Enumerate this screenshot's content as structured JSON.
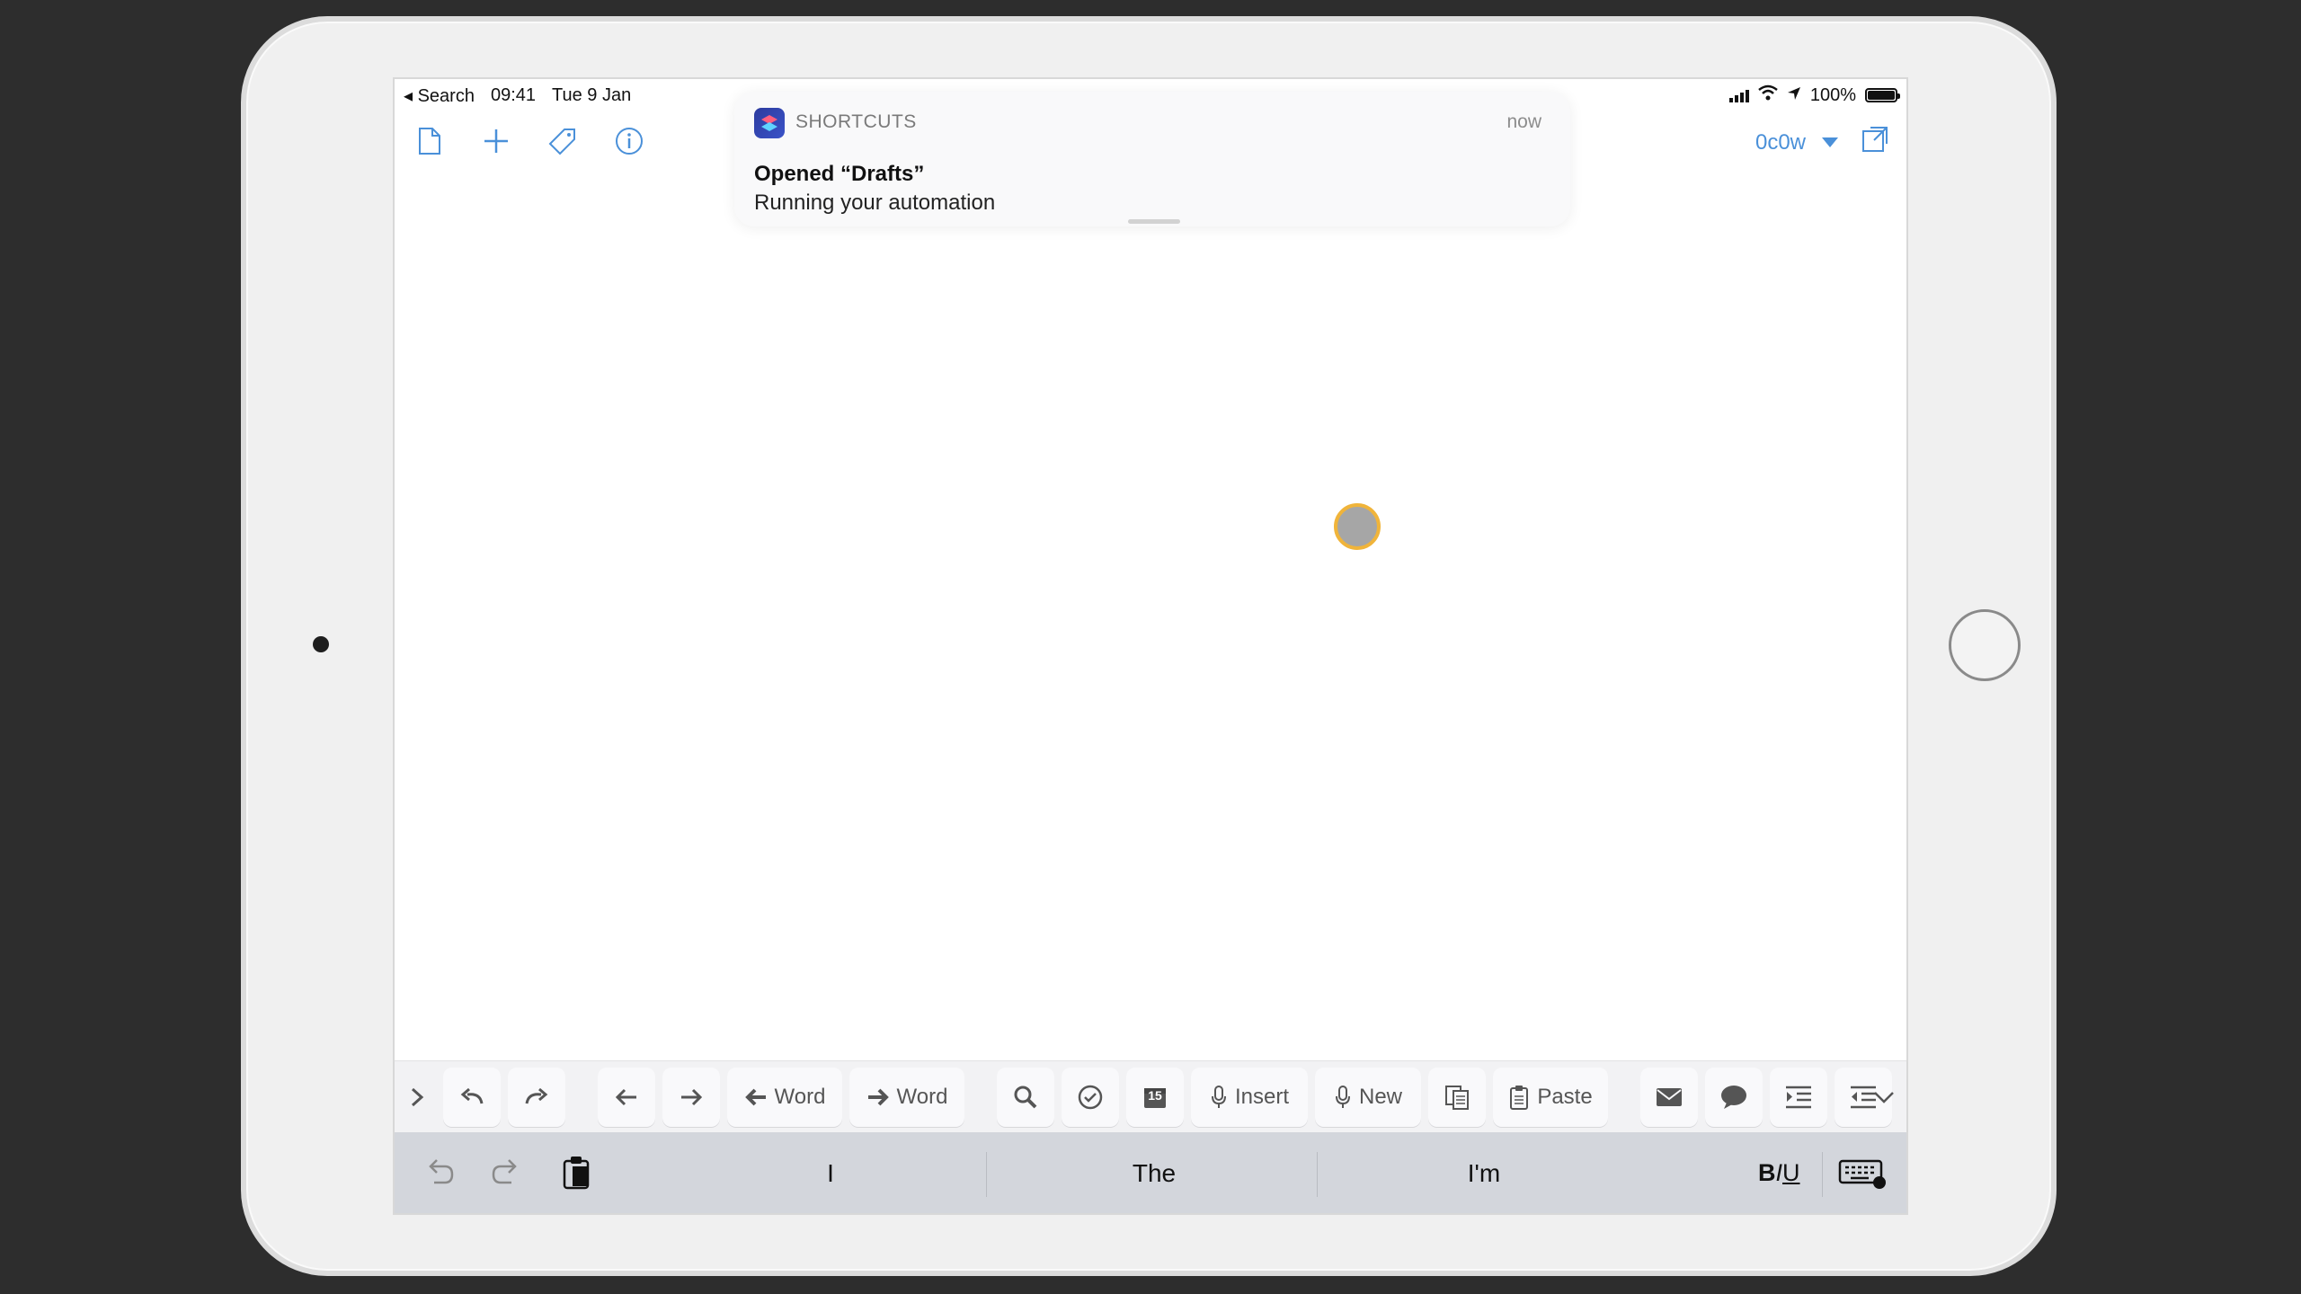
{
  "status_bar": {
    "back_label": "◂ Search",
    "time": "09:41",
    "date": "Tue 9 Jan",
    "battery": "100%"
  },
  "toolbar": {
    "left_icons": [
      "new-document-icon",
      "plus-icon",
      "tag-icon",
      "info-icon"
    ],
    "word_count": "0c0w"
  },
  "notification": {
    "app_name": "SHORTCUTS",
    "time": "now",
    "title": "Opened “Drafts”",
    "body": "Running your automation"
  },
  "extended_keyboard": {
    "keys": {
      "word_left": "Word",
      "word_right": "Word",
      "insert": "Insert",
      "new": "New",
      "paste": "Paste"
    },
    "calendar_day": "15"
  },
  "quicktype": {
    "suggestions": [
      "I",
      "The",
      "I'm"
    ],
    "format_b": "B",
    "format_i": "I",
    "format_u": "U"
  },
  "colors": {
    "accent": "#4a90d9",
    "touch_indicator": "#f0b43a",
    "background": "#2d2d2d"
  }
}
